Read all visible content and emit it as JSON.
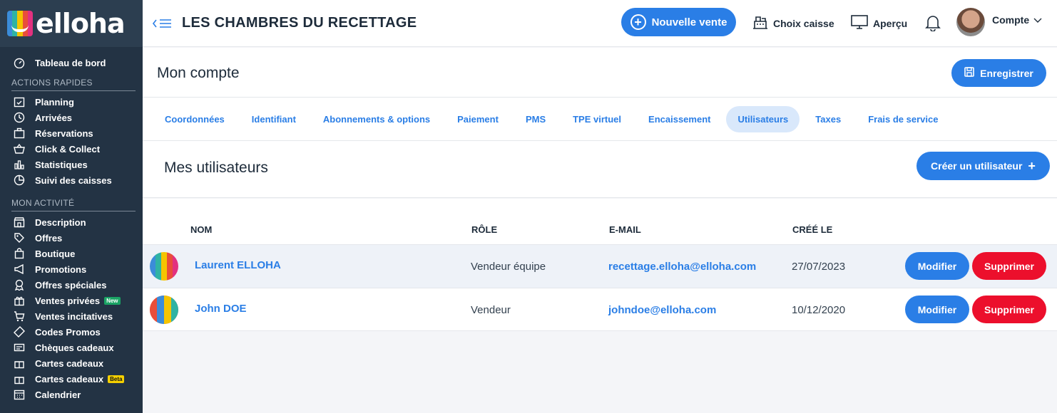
{
  "brand": {
    "name": "elloha",
    "colors": [
      "#3b8cd9",
      "#2fb3a4",
      "#f5c400",
      "#e94e3a",
      "#e2317f"
    ]
  },
  "sidebar": {
    "dashboard": "Tableau de bord",
    "quick_actions_title": "ACTIONS RAPIDES",
    "quick_actions": [
      {
        "label": "Planning",
        "icon": "calendar-check-icon"
      },
      {
        "label": "Arrivées",
        "icon": "clock-icon"
      },
      {
        "label": "Réservations",
        "icon": "briefcase-icon"
      },
      {
        "label": "Click & Collect",
        "icon": "basket-icon"
      },
      {
        "label": "Statistiques",
        "icon": "bar-chart-icon"
      },
      {
        "label": "Suivi des caisses",
        "icon": "pie-chart-icon"
      }
    ],
    "activity_title": "MON ACTIVITÉ",
    "activity": [
      {
        "label": "Description",
        "icon": "storefront-icon"
      },
      {
        "label": "Offres",
        "icon": "tag-icon"
      },
      {
        "label": "Boutique",
        "icon": "shopping-bag-icon"
      },
      {
        "label": "Promotions",
        "icon": "megaphone-icon"
      },
      {
        "label": "Offres spéciales",
        "icon": "ribbon-icon"
      },
      {
        "label": "Ventes privées",
        "icon": "gift-icon",
        "badge": "New"
      },
      {
        "label": "Ventes incitatives",
        "icon": "cart-icon"
      },
      {
        "label": "Codes Promos",
        "icon": "coupon-icon"
      },
      {
        "label": "Chèques cadeaux",
        "icon": "voucher-icon"
      },
      {
        "label": "Cartes cadeaux",
        "icon": "gift-card-icon"
      },
      {
        "label": "Cartes cadeaux",
        "icon": "gift-card-icon",
        "badge": "Beta"
      },
      {
        "label": "Calendrier",
        "icon": "calendar-icon"
      }
    ]
  },
  "header": {
    "hotel_name": "LES CHAMBRES DU RECETTAGE",
    "new_sale": "Nouvelle vente",
    "cash_register": "Choix caisse",
    "preview": "Aperçu",
    "account": "Compte"
  },
  "page": {
    "title": "Mon compte",
    "save": "Enregistrer"
  },
  "tabs": [
    {
      "label": "Coordonnées",
      "active": false
    },
    {
      "label": "Identifiant",
      "active": false
    },
    {
      "label": "Abonnements & options",
      "active": false
    },
    {
      "label": "Paiement",
      "active": false
    },
    {
      "label": "PMS",
      "active": false
    },
    {
      "label": "TPE virtuel",
      "active": false
    },
    {
      "label": "Encaissement",
      "active": false
    },
    {
      "label": "Utilisateurs",
      "active": true
    },
    {
      "label": "Taxes",
      "active": false
    },
    {
      "label": "Frais de service",
      "active": false
    }
  ],
  "users": {
    "title": "Mes utilisateurs",
    "create": "Créer un utilisateur",
    "columns": {
      "name": "NOM",
      "role": "RÔLE",
      "email": "E-MAIL",
      "created": "CRÉÉ LE"
    },
    "rows": [
      {
        "name": "Laurent ELLOHA",
        "role": "Vendeur équipe",
        "email": "recettage.elloha@elloha.com",
        "created": "27/07/2023"
      },
      {
        "name": "John DOE",
        "role": "Vendeur",
        "email": "johndoe@elloha.com",
        "created": "10/12/2020"
      }
    ],
    "edit": "Modifier",
    "delete": "Supprimer"
  }
}
